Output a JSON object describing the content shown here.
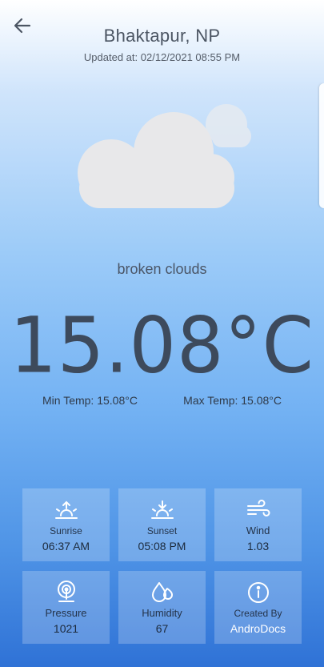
{
  "header": {
    "city": "Bhaktapur, NP",
    "updated": "Updated at: 02/12/2021 08:55 PM"
  },
  "weather": {
    "icon": "cloud-icon",
    "condition": "broken clouds",
    "temperature": "15.08°C",
    "min_temp": "Min Temp: 15.08°C",
    "max_temp": "Max Temp: 15.08°C"
  },
  "cards": [
    {
      "label": "Sunrise",
      "value": "06:37 AM",
      "icon": "sunrise-icon"
    },
    {
      "label": "Sunset",
      "value": "05:08 PM",
      "icon": "sunset-icon"
    },
    {
      "label": "Wind",
      "value": "1.03",
      "icon": "wind-icon"
    },
    {
      "label": "Pressure",
      "value": "1021",
      "icon": "pressure-icon"
    },
    {
      "label": "Humidity",
      "value": "67",
      "icon": "humidity-icon"
    },
    {
      "label": "Created By",
      "value": "AndroDocs",
      "icon": "info-icon"
    }
  ],
  "colors": {
    "gradient_top": "#ffffff",
    "gradient_bottom": "#2f72d6",
    "text": "#4a5566"
  }
}
